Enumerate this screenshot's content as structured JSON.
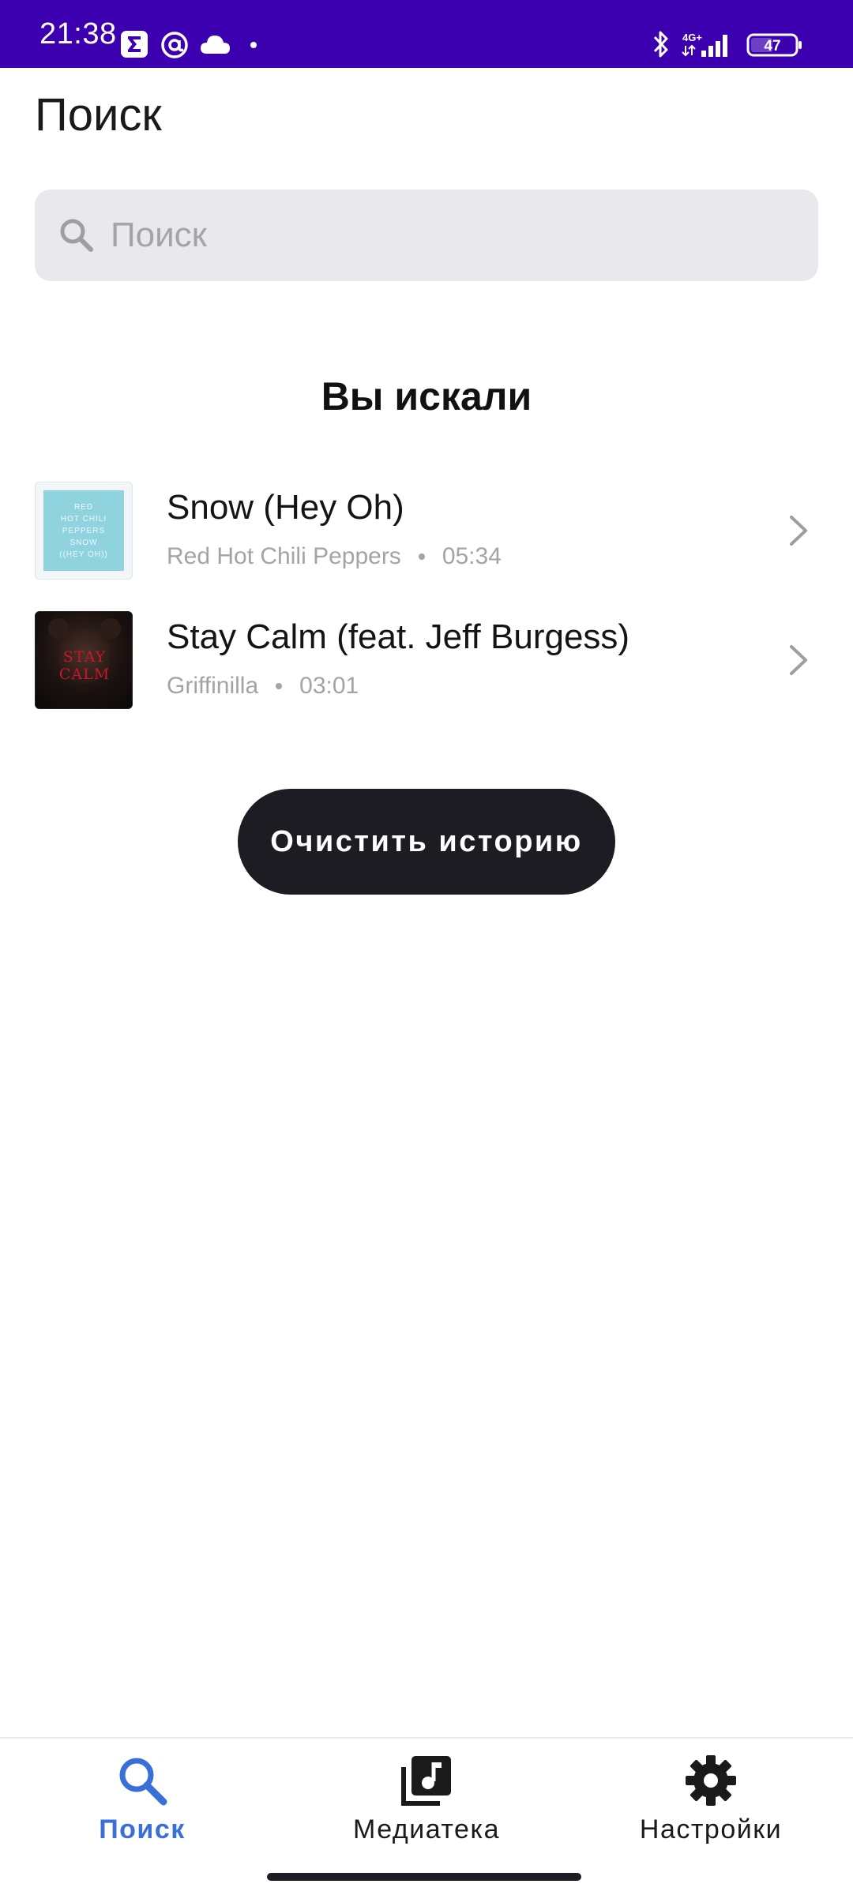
{
  "status_bar": {
    "time": "21:38",
    "network": "4G+",
    "battery": "47",
    "icons": [
      "sigma-icon",
      "at-icon",
      "cloud-icon",
      "dot-icon",
      "bluetooth-icon",
      "signal-icon",
      "battery-icon"
    ]
  },
  "page": {
    "title": "Поиск"
  },
  "search": {
    "placeholder": "Поиск",
    "value": "",
    "icon": "search-icon"
  },
  "history": {
    "title": "Вы искали",
    "items": [
      {
        "title": "Snow (Hey Oh)",
        "artist": "Red Hot Chili Peppers",
        "duration": "05:34",
        "cover_lines": [
          "RED",
          "HOT CHILI",
          "PEPPERS",
          "SNOW",
          "((HEY OH))"
        ]
      },
      {
        "title": "Stay Calm (feat. Jeff Burgess)",
        "artist": "Griffinilla",
        "duration": "03:01",
        "cover_text": "STAY CALM"
      }
    ],
    "clear_label": "Очистить историю"
  },
  "bottom_nav": {
    "items": [
      {
        "label": "Поиск",
        "icon": "search-icon",
        "active": true
      },
      {
        "label": "Медиатека",
        "icon": "music-library-icon",
        "active": false
      },
      {
        "label": "Настройки",
        "icon": "gear-icon",
        "active": false
      }
    ]
  },
  "colors": {
    "status_bar": "#3d00b0",
    "accent": "#3a6fd8",
    "button_bg": "#1c1c22",
    "search_bg": "#e9e9ed",
    "muted_text": "#a3a3a8"
  }
}
